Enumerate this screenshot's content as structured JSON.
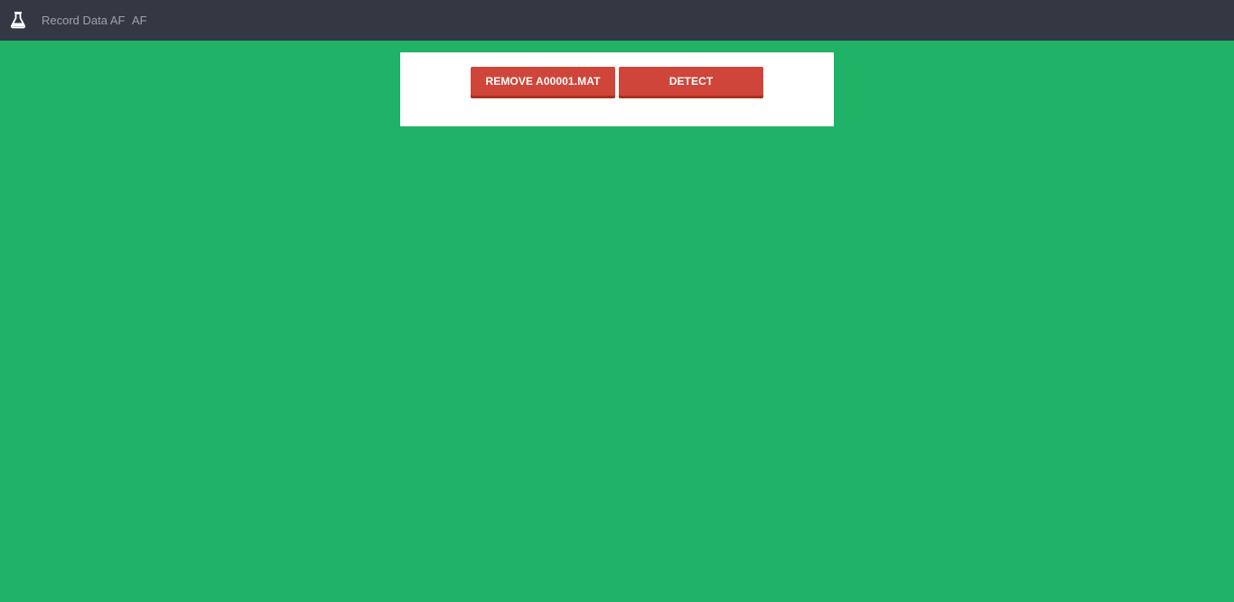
{
  "navbar": {
    "logo_icon": "flask-icon",
    "links": [
      {
        "label": "Record Data AF"
      },
      {
        "label": "AF"
      }
    ]
  },
  "actions": {
    "remove_label": "REMOVE A00001.MAT",
    "detect_label": "DETECT"
  },
  "colors": {
    "background": "#20b267",
    "navbar": "#343843",
    "button": "#d04539",
    "nav_text": "#9ea2aa"
  }
}
